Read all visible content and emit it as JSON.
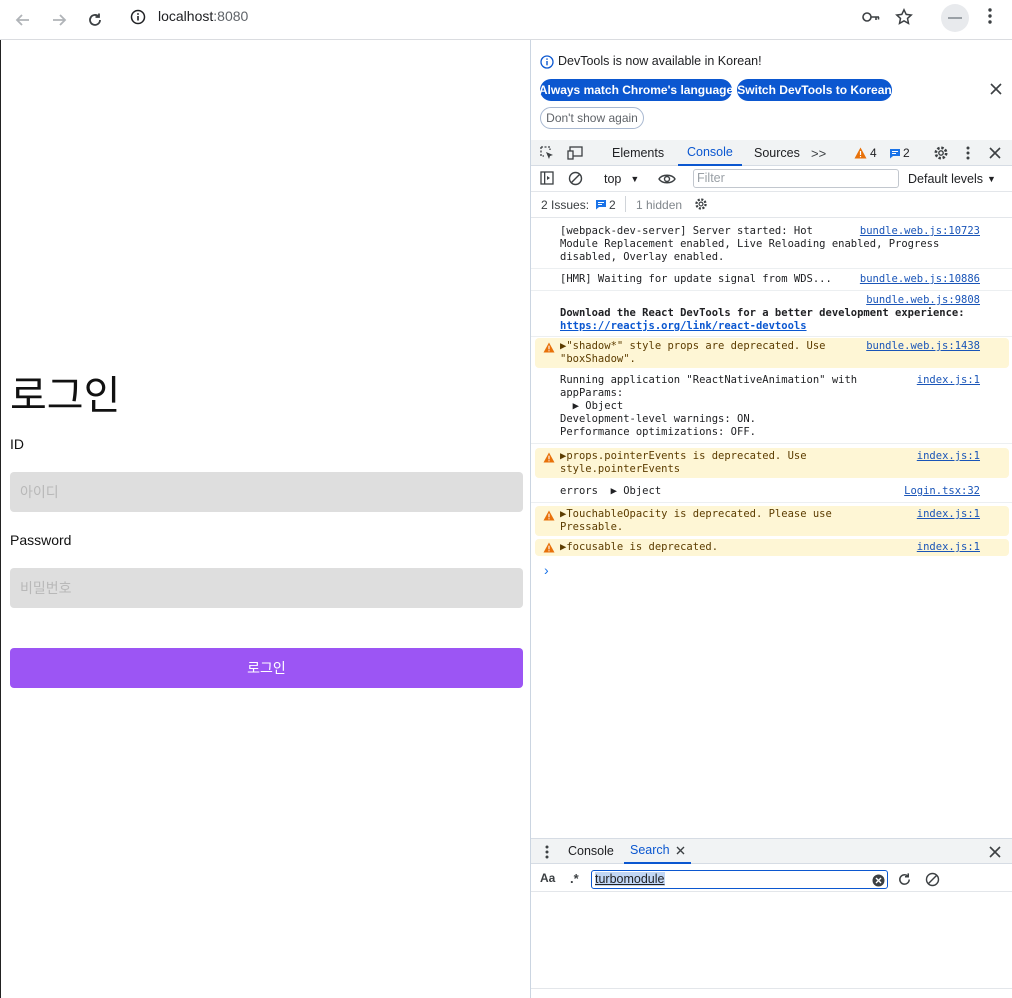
{
  "browser": {
    "url_host": "localhost",
    "url_port": ":8080",
    "icons": [
      "back-icon",
      "forward-icon",
      "reload-icon",
      "site-info-icon",
      "key-icon",
      "star-icon",
      "profile-icon",
      "menu-icon"
    ]
  },
  "app": {
    "title": "로그인",
    "id_label": "ID",
    "id_placeholder": "아이디",
    "password_label": "Password",
    "password_placeholder": "비밀번호",
    "login_button": "로그인",
    "accent_color": "#9c55f4"
  },
  "devtools": {
    "infobar": {
      "message": "DevTools is now available in Korean!",
      "btn_match": "Always match Chrome's language",
      "btn_switch": "Switch DevTools to Korean",
      "btn_dismiss": "Don't show again"
    },
    "tabs": {
      "elements": "Elements",
      "console": "Console",
      "sources": "Sources",
      "more": ">>",
      "warn_count": "4",
      "msg_count": "2"
    },
    "console_toolbar": {
      "context": "top",
      "filter_placeholder": "Filter",
      "levels": "Default levels"
    },
    "issues": {
      "label": "2 Issues:",
      "count": "2",
      "hidden": "1 hidden"
    },
    "messages": [
      {
        "type": "log",
        "text": "[webpack-dev-server] Server started: Hot\nModule Replacement enabled, Live Reloading enabled, Progress\ndisabled, Overlay enabled.",
        "source": "bundle.web.js:10723"
      },
      {
        "type": "log",
        "text": "[HMR] Waiting for update signal from WDS...",
        "source": "bundle.web.js:10886"
      },
      {
        "type": "log",
        "text": "Download the React DevTools for a better development experience:",
        "link": "https://reactjs.org/link/react-devtools",
        "source": "bundle.web.js:9808"
      },
      {
        "type": "warn",
        "text": "▶\"shadow*\" style props are deprecated. Use\n\"boxShadow\".",
        "source": "bundle.web.js:1438"
      },
      {
        "type": "log",
        "text": "Running application \"ReactNativeAnimation\" with\nappParams:\n  ▶ Object\nDevelopment-level warnings: ON.\nPerformance optimizations: OFF.",
        "source": "index.js:1"
      },
      {
        "type": "warn",
        "text": "▶props.pointerEvents is deprecated. Use\nstyle.pointerEvents",
        "source": "index.js:1"
      },
      {
        "type": "log",
        "text": "errors  ▶ Object",
        "source": "Login.tsx:32"
      },
      {
        "type": "warn",
        "text": "▶TouchableOpacity is deprecated. Please use\nPressable.",
        "source": "index.js:1"
      },
      {
        "type": "warn",
        "text": "▶focusable is deprecated.",
        "source": "index.js:1"
      }
    ],
    "prompt": "›",
    "drawer": {
      "tab_console": "Console",
      "tab_search": "Search",
      "case_toggle": "Aa",
      "regex_toggle": ".*",
      "search_value": "turbomodule"
    }
  }
}
